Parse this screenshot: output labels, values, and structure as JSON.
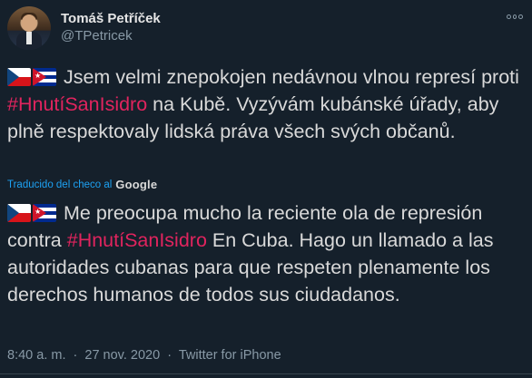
{
  "author": {
    "name": "Tomáš Petříček",
    "handle": "@TPetricek"
  },
  "tweet": {
    "original": {
      "before_tag": " Jsem velmi znepokojen nedávnou vlnou represí proti ",
      "hashtag": "#HnutíSanIsidro",
      "after_tag": " na Kubě. Vyzývám kubánské úřady, aby plně respektovaly lidská práva všech svých občanů."
    },
    "translation_label": "Traducido del checo al",
    "translation_brand": "Google",
    "translated": {
      "before_tag": " Me preocupa mucho la reciente ola de represión contra ",
      "hashtag": "#HnutíSanIsidro",
      "after_tag": " En Cuba. Hago un llamado a las autoridades cubanas para que respeten plenamente los derechos humanos de todos sus ciudadanos."
    },
    "time": "8:40 a. m.",
    "sep1": "·",
    "date": "27 nov. 2020",
    "sep2": "·",
    "source": "Twitter for iPhone"
  },
  "colors": {
    "background": "#15202b",
    "hashtag": "#e0245e",
    "link": "#1da1f2",
    "secondary": "#8899a6"
  },
  "icons": [
    "czech-flag-icon",
    "cuba-flag-icon",
    "more-options-icon"
  ]
}
